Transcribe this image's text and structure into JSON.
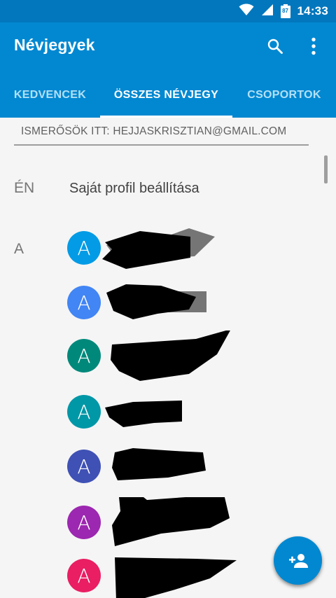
{
  "status_bar": {
    "battery_level": "87",
    "time": "14:33"
  },
  "app_bar": {
    "title": "Névjegyek"
  },
  "tabs": [
    {
      "label": "KEDVENCEK",
      "active": false
    },
    {
      "label": "ÖSSZES NÉVJEGY",
      "active": true
    },
    {
      "label": "CSOPORTOK",
      "active": false
    }
  ],
  "account_header": "ISMERŐSÖK ITT: HEJJASKRISZTIAN@GMAIL.COM",
  "me_section": {
    "letter": "ÉN",
    "label": "Saját profil beállítása"
  },
  "contacts_section": {
    "letter": "A"
  },
  "contacts": [
    {
      "initial": "A",
      "color": "#039be5"
    },
    {
      "initial": "A",
      "color": "#4285f4"
    },
    {
      "initial": "A",
      "color": "#00897b"
    },
    {
      "initial": "A",
      "color": "#0097a7"
    },
    {
      "initial": "A",
      "color": "#3f51b5"
    },
    {
      "initial": "A",
      "color": "#9c27b0"
    },
    {
      "initial": "A",
      "color": "#e91e63"
    }
  ],
  "colors": {
    "status_bar": "#0277bd",
    "app_bar": "#0288d1",
    "fab": "#0288d1"
  },
  "fab": {
    "icon": "add-person-icon"
  }
}
